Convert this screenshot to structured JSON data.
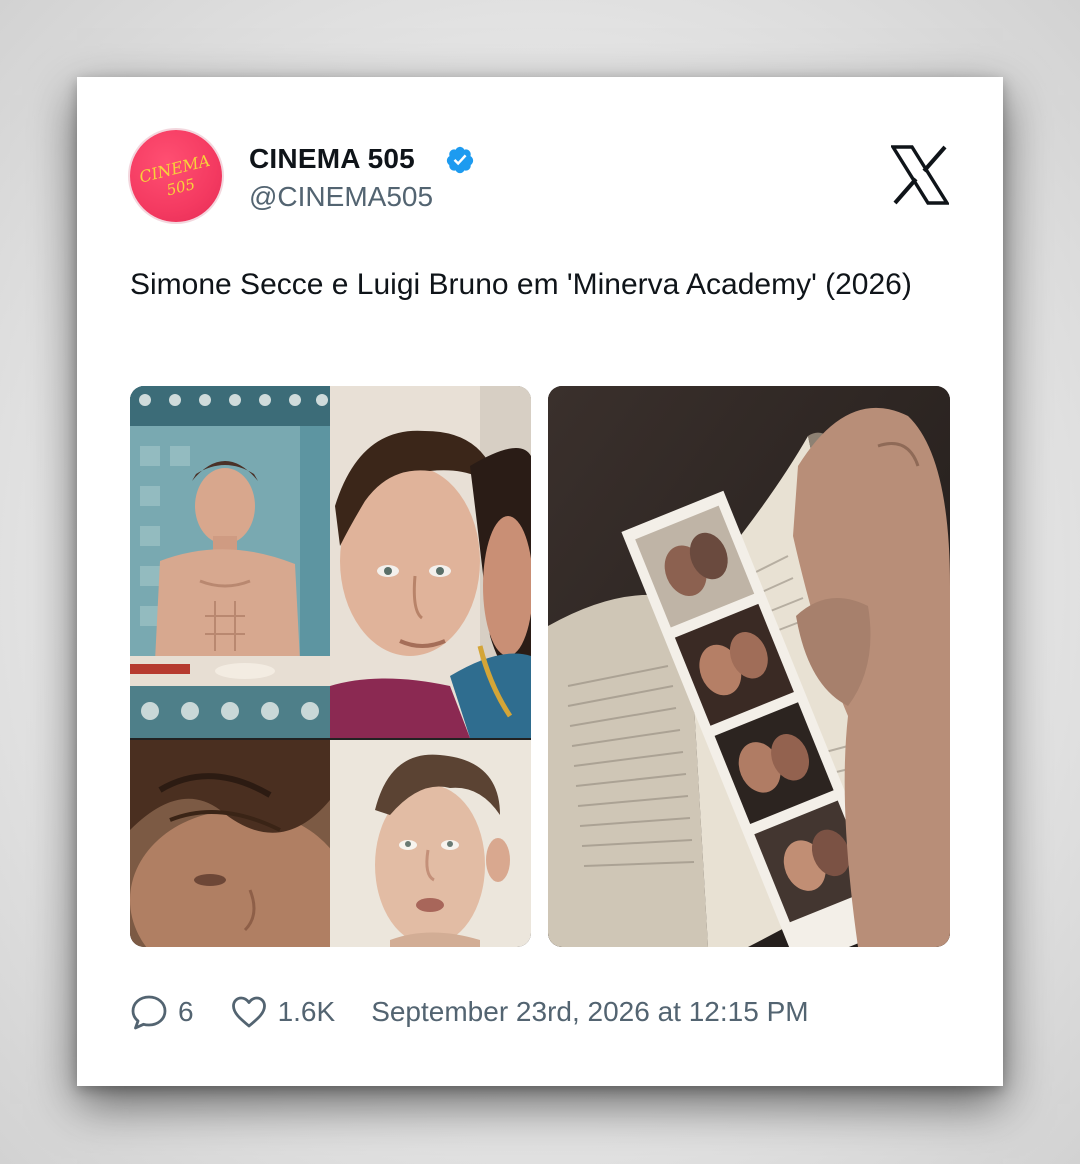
{
  "post": {
    "author": {
      "display_name": "CINEMA 505",
      "handle": "@CINEMA505",
      "verified": true,
      "avatar_text_line1": "CINEMA",
      "avatar_text_line2": "505",
      "avatar_color": "#f43a61"
    },
    "platform_icon": "x-logo-icon",
    "text": "Simone Secce e Luigi Bruno em 'Minerva Academy' (2026)",
    "media": [
      {
        "name": "collage-photo-kitchen"
      },
      {
        "name": "collage-photo-closeup-pair"
      },
      {
        "name": "collage-photo-wet-hair"
      },
      {
        "name": "collage-photo-looking-up"
      },
      {
        "name": "photo-book-with-photostrip"
      }
    ],
    "stats": {
      "replies": "6",
      "likes": "1.6K"
    },
    "timestamp": "September 23rd, 2026 at 12:15 PM"
  },
  "colors": {
    "text_primary": "#0f1419",
    "text_secondary": "#536471",
    "verified_blue": "#1d9bf0",
    "card_background": "#ffffff"
  }
}
